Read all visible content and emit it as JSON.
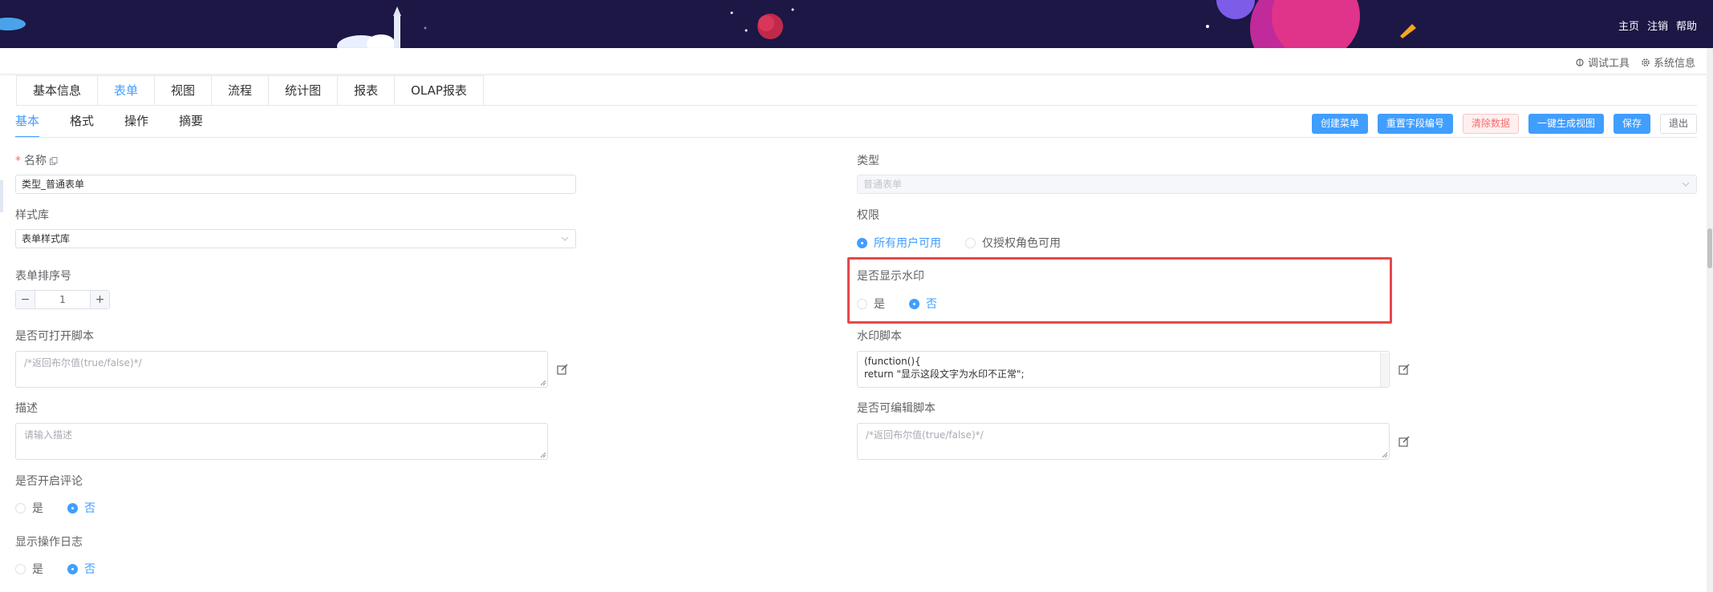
{
  "header": {
    "links": [
      "主页",
      "注销",
      "帮助"
    ],
    "tools": [
      {
        "icon": "bug-icon",
        "label": "调试工具"
      },
      {
        "icon": "gear-icon",
        "label": "系统信息"
      }
    ]
  },
  "main_tabs": {
    "items": [
      "基本信息",
      "表单",
      "视图",
      "流程",
      "统计图",
      "报表",
      "OLAP报表"
    ],
    "active": "表单"
  },
  "sub_tabs": {
    "items": [
      "基本",
      "格式",
      "操作",
      "摘要"
    ],
    "active": "基本"
  },
  "actions": {
    "create_menu": "创建菜单",
    "reset_field_no": "重置字段编号",
    "clear_data": "清除数据",
    "gen_view": "一键生成视图",
    "save": "保存",
    "exit": "退出"
  },
  "form": {
    "name": {
      "label": "名称",
      "value": "类型_普通表单"
    },
    "style_lib": {
      "label": "样式库",
      "value": "表单样式库"
    },
    "sort_no": {
      "label": "表单排序号",
      "value": "1",
      "minus": "−",
      "plus": "+"
    },
    "open_script": {
      "label": "是否可打开脚本",
      "placeholder": "/*返回布尔值(true/false)*/"
    },
    "description": {
      "label": "描述",
      "placeholder": "请输入描述"
    },
    "comment": {
      "label": "是否开启评论",
      "yes": "是",
      "no": "否",
      "selected": "否"
    },
    "op_log": {
      "label": "显示操作日志",
      "yes": "是",
      "no": "否",
      "selected": "否"
    },
    "type": {
      "label": "类型",
      "value": "普通表单"
    },
    "permission": {
      "label": "权限",
      "all": "所有用户可用",
      "auth": "仅授权角色可用",
      "selected": "所有用户可用"
    },
    "watermark": {
      "label": "是否显示水印",
      "yes": "是",
      "no": "否",
      "selected": "否"
    },
    "watermark_script": {
      "label": "水印脚本",
      "line1": "(function(){",
      "line2": "return \"显示这段文字为水印不正常\";"
    },
    "edit_script": {
      "label": "是否可编辑脚本",
      "placeholder": "/*返回布尔值(true/false)*/"
    }
  },
  "colors": {
    "primary": "#409eff",
    "danger": "#f56c6c",
    "banner": "#1c1745",
    "highlight": "#e8474a"
  }
}
